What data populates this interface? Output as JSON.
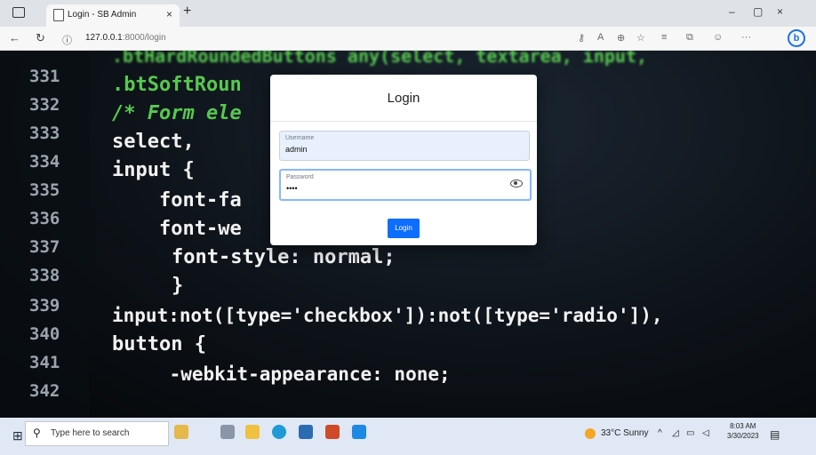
{
  "browser": {
    "tab_title": "Login - SB Admin",
    "tab_close": "×",
    "new_tab": "+",
    "url_host": "127.0.0.1",
    "url_path": ":8000/login",
    "minimize": "–",
    "restore": "▢",
    "close": "×",
    "bing": "b"
  },
  "background_code": {
    "line_numbers": [
      "331",
      "332",
      "333",
      "334",
      "335",
      "336",
      "337",
      "338",
      "339",
      "340",
      "341",
      "342"
    ],
    "lines": [
      ".btHardRoundedButtons any(select, textarea, input,",
      ".btSoftRoun",
      "/* Form ele",
      "select,",
      "input {",
      "    font-fa",
      "    font-we",
      "    font-style: normal;",
      "    }",
      "input:not([type='checkbox']):not([type='radio']),",
      "button {",
      "    -webkit-appearance: none;"
    ]
  },
  "login": {
    "title": "Login",
    "username_label": "Username",
    "username_value": "admin",
    "password_label": "Password",
    "password_value": "••••",
    "submit_label": "Login"
  },
  "taskbar": {
    "search_placeholder": "Type here to search",
    "weather": "33°C  Sunny",
    "time": "8:03 AM",
    "date": "3/30/2023"
  }
}
